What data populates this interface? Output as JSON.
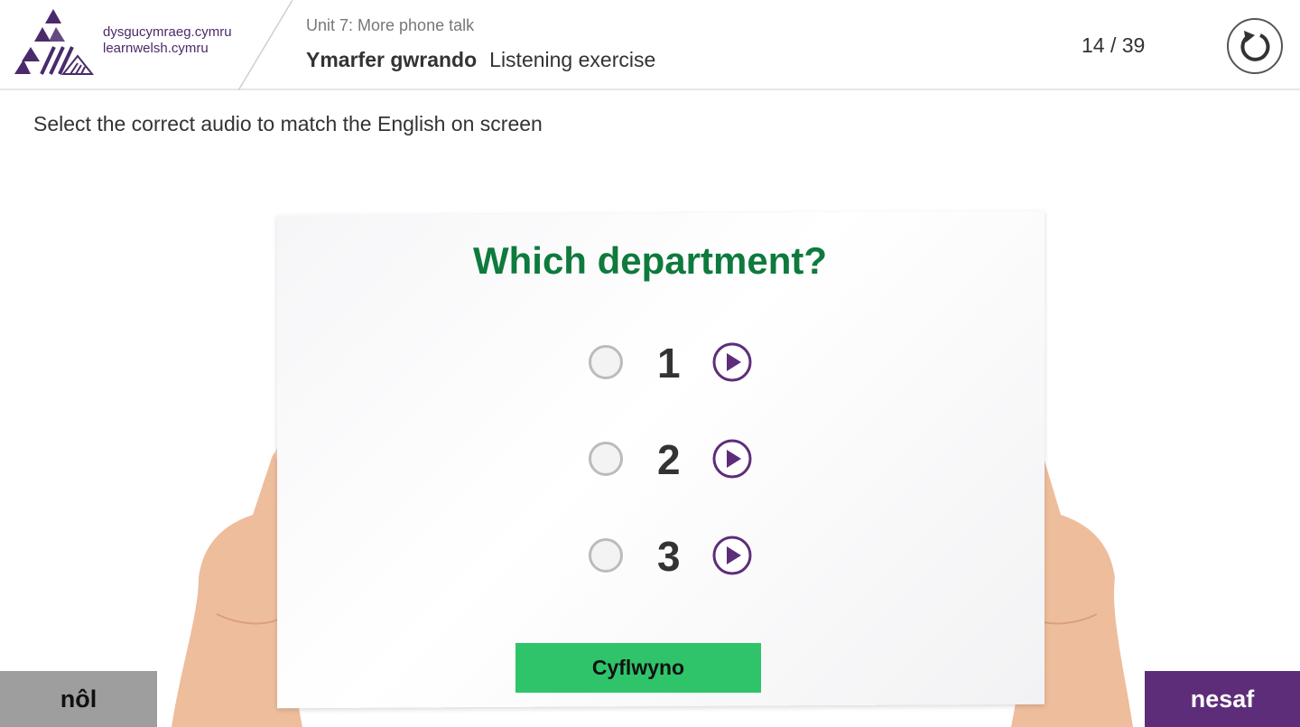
{
  "brand": {
    "line1": "dysgucymraeg.cymru",
    "line2": "learnwelsh.cymru",
    "color": "#4a2a6b"
  },
  "header": {
    "unit": "Unit 7:  More phone talk",
    "title_welsh": "Ymarfer gwrando",
    "title_english": "Listening exercise",
    "counter": "14 / 39"
  },
  "instruction": "Select the correct audio to match the English on screen",
  "exercise": {
    "question": "Which department?",
    "options": [
      {
        "label": "1",
        "selected": false
      },
      {
        "label": "2",
        "selected": false
      },
      {
        "label": "3",
        "selected": false
      }
    ],
    "submit_label": "Cyflwyno"
  },
  "nav": {
    "back_label": "nôl",
    "next_label": "nesaf"
  },
  "colors": {
    "accent_purple": "#5e2d79",
    "question_green": "#0e7a3c",
    "submit_green": "#2fc46a",
    "back_grey": "#9e9e9e"
  },
  "icons": {
    "reset": "refresh-icon",
    "play": "play-circle-icon",
    "logo": "triangle-logo-icon"
  }
}
